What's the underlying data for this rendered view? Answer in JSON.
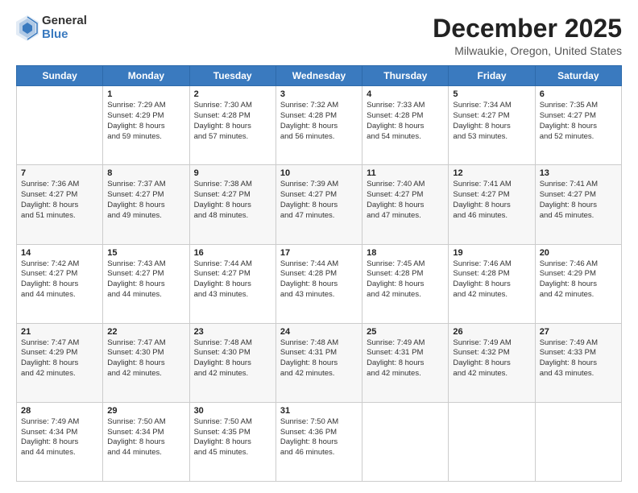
{
  "logo": {
    "general": "General",
    "blue": "Blue"
  },
  "title": "December 2025",
  "location": "Milwaukie, Oregon, United States",
  "days_of_week": [
    "Sunday",
    "Monday",
    "Tuesday",
    "Wednesday",
    "Thursday",
    "Friday",
    "Saturday"
  ],
  "weeks": [
    [
      {
        "day": "",
        "info": ""
      },
      {
        "day": "1",
        "info": "Sunrise: 7:29 AM\nSunset: 4:29 PM\nDaylight: 8 hours\nand 59 minutes."
      },
      {
        "day": "2",
        "info": "Sunrise: 7:30 AM\nSunset: 4:28 PM\nDaylight: 8 hours\nand 57 minutes."
      },
      {
        "day": "3",
        "info": "Sunrise: 7:32 AM\nSunset: 4:28 PM\nDaylight: 8 hours\nand 56 minutes."
      },
      {
        "day": "4",
        "info": "Sunrise: 7:33 AM\nSunset: 4:28 PM\nDaylight: 8 hours\nand 54 minutes."
      },
      {
        "day": "5",
        "info": "Sunrise: 7:34 AM\nSunset: 4:27 PM\nDaylight: 8 hours\nand 53 minutes."
      },
      {
        "day": "6",
        "info": "Sunrise: 7:35 AM\nSunset: 4:27 PM\nDaylight: 8 hours\nand 52 minutes."
      }
    ],
    [
      {
        "day": "7",
        "info": "Sunrise: 7:36 AM\nSunset: 4:27 PM\nDaylight: 8 hours\nand 51 minutes."
      },
      {
        "day": "8",
        "info": "Sunrise: 7:37 AM\nSunset: 4:27 PM\nDaylight: 8 hours\nand 49 minutes."
      },
      {
        "day": "9",
        "info": "Sunrise: 7:38 AM\nSunset: 4:27 PM\nDaylight: 8 hours\nand 48 minutes."
      },
      {
        "day": "10",
        "info": "Sunrise: 7:39 AM\nSunset: 4:27 PM\nDaylight: 8 hours\nand 47 minutes."
      },
      {
        "day": "11",
        "info": "Sunrise: 7:40 AM\nSunset: 4:27 PM\nDaylight: 8 hours\nand 47 minutes."
      },
      {
        "day": "12",
        "info": "Sunrise: 7:41 AM\nSunset: 4:27 PM\nDaylight: 8 hours\nand 46 minutes."
      },
      {
        "day": "13",
        "info": "Sunrise: 7:41 AM\nSunset: 4:27 PM\nDaylight: 8 hours\nand 45 minutes."
      }
    ],
    [
      {
        "day": "14",
        "info": "Sunrise: 7:42 AM\nSunset: 4:27 PM\nDaylight: 8 hours\nand 44 minutes."
      },
      {
        "day": "15",
        "info": "Sunrise: 7:43 AM\nSunset: 4:27 PM\nDaylight: 8 hours\nand 44 minutes."
      },
      {
        "day": "16",
        "info": "Sunrise: 7:44 AM\nSunset: 4:27 PM\nDaylight: 8 hours\nand 43 minutes."
      },
      {
        "day": "17",
        "info": "Sunrise: 7:44 AM\nSunset: 4:28 PM\nDaylight: 8 hours\nand 43 minutes."
      },
      {
        "day": "18",
        "info": "Sunrise: 7:45 AM\nSunset: 4:28 PM\nDaylight: 8 hours\nand 42 minutes."
      },
      {
        "day": "19",
        "info": "Sunrise: 7:46 AM\nSunset: 4:28 PM\nDaylight: 8 hours\nand 42 minutes."
      },
      {
        "day": "20",
        "info": "Sunrise: 7:46 AM\nSunset: 4:29 PM\nDaylight: 8 hours\nand 42 minutes."
      }
    ],
    [
      {
        "day": "21",
        "info": "Sunrise: 7:47 AM\nSunset: 4:29 PM\nDaylight: 8 hours\nand 42 minutes."
      },
      {
        "day": "22",
        "info": "Sunrise: 7:47 AM\nSunset: 4:30 PM\nDaylight: 8 hours\nand 42 minutes."
      },
      {
        "day": "23",
        "info": "Sunrise: 7:48 AM\nSunset: 4:30 PM\nDaylight: 8 hours\nand 42 minutes."
      },
      {
        "day": "24",
        "info": "Sunrise: 7:48 AM\nSunset: 4:31 PM\nDaylight: 8 hours\nand 42 minutes."
      },
      {
        "day": "25",
        "info": "Sunrise: 7:49 AM\nSunset: 4:31 PM\nDaylight: 8 hours\nand 42 minutes."
      },
      {
        "day": "26",
        "info": "Sunrise: 7:49 AM\nSunset: 4:32 PM\nDaylight: 8 hours\nand 42 minutes."
      },
      {
        "day": "27",
        "info": "Sunrise: 7:49 AM\nSunset: 4:33 PM\nDaylight: 8 hours\nand 43 minutes."
      }
    ],
    [
      {
        "day": "28",
        "info": "Sunrise: 7:49 AM\nSunset: 4:34 PM\nDaylight: 8 hours\nand 44 minutes."
      },
      {
        "day": "29",
        "info": "Sunrise: 7:50 AM\nSunset: 4:34 PM\nDaylight: 8 hours\nand 44 minutes."
      },
      {
        "day": "30",
        "info": "Sunrise: 7:50 AM\nSunset: 4:35 PM\nDaylight: 8 hours\nand 45 minutes."
      },
      {
        "day": "31",
        "info": "Sunrise: 7:50 AM\nSunset: 4:36 PM\nDaylight: 8 hours\nand 46 minutes."
      },
      {
        "day": "",
        "info": ""
      },
      {
        "day": "",
        "info": ""
      },
      {
        "day": "",
        "info": ""
      }
    ]
  ]
}
